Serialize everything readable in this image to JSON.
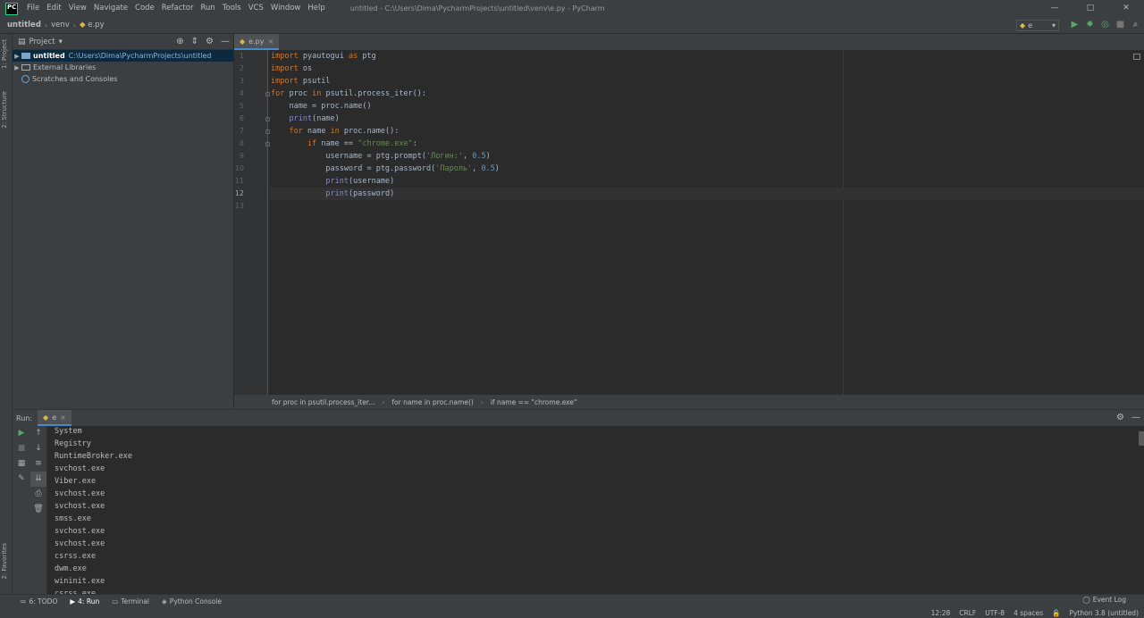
{
  "window": {
    "title": "untitled - C:\\Users\\Dima\\PycharmProjects\\untitled\\venv\\e.py - PyCharm",
    "logo_text": "PC",
    "minimize": "—",
    "maximize": "□",
    "close": "✕"
  },
  "menu": [
    "File",
    "Edit",
    "View",
    "Navigate",
    "Code",
    "Refactor",
    "Run",
    "Tools",
    "VCS",
    "Window",
    "Help"
  ],
  "navbar": {
    "crumbs": [
      "untitled",
      "venv",
      "e.py"
    ],
    "run_config": "e"
  },
  "side_tabs": {
    "project": "1: Project",
    "structure": "2: Structure",
    "favorites": "2: Favorites"
  },
  "project_panel": {
    "title": "Project",
    "tree": [
      {
        "label": "untitled",
        "path": "C:\\Users\\Dima\\PycharmProjects\\untitled"
      },
      {
        "label": "External Libraries",
        "path": ""
      },
      {
        "label": "Scratches and Consoles",
        "path": ""
      }
    ]
  },
  "editor": {
    "tab_label": "e.py",
    "line_numbers": [
      "1",
      "2",
      "3",
      "4",
      "5",
      "6",
      "7",
      "8",
      "9",
      "10",
      "11",
      "12",
      "13"
    ],
    "breadcrumbs": [
      "for proc in psutil.process_iter...",
      "for name in proc.name()",
      "if name == \"chrome.exe\""
    ]
  },
  "code_tokens": {
    "l1": [
      "import",
      " pyautogui ",
      "as",
      " ptg"
    ],
    "l2": [
      "import",
      " os"
    ],
    "l3": [
      "import",
      " psutil"
    ],
    "l4": [
      "for",
      " proc ",
      "in",
      " psutil.process_iter():"
    ],
    "l5": [
      "    name = proc.name()"
    ],
    "l6": [
      "    ",
      "print",
      "(name)"
    ],
    "l7": [
      "    ",
      "for",
      " name ",
      "in",
      " proc.name():"
    ],
    "l8": [
      "        ",
      "if",
      " name == ",
      "\"chrome.exe\"",
      ":"
    ],
    "l9": [
      "            username = ptg.prompt(",
      "'Логин:'",
      ", ",
      "0.5",
      ")"
    ],
    "l10": [
      "            password = ptg.password(",
      "'Пароль'",
      ", ",
      "0.5",
      ")"
    ],
    "l11": [
      "            ",
      "print",
      "(username)"
    ],
    "l12": [
      "            ",
      "print",
      "(password)"
    ],
    "l13": [
      ""
    ]
  },
  "run_panel": {
    "label": "Run:",
    "tab": "e",
    "output": [
      "System",
      "Registry",
      "RuntimeBroker.exe",
      "svchost.exe",
      "Viber.exe",
      "svchost.exe",
      "svchost.exe",
      "smss.exe",
      "svchost.exe",
      "svchost.exe",
      "csrss.exe",
      "dwm.exe",
      "wininit.exe",
      "csrss.exe"
    ]
  },
  "bottom_tools": {
    "todo": "6: TODO",
    "run": "4: Run",
    "terminal": "Terminal",
    "python_console": "Python Console",
    "event_log": "Event Log"
  },
  "status": {
    "position": "12:28",
    "line_sep": "CRLF",
    "encoding": "UTF-8",
    "indent": "4 spaces",
    "interpreter": "Python 3.8 (untitled)"
  }
}
